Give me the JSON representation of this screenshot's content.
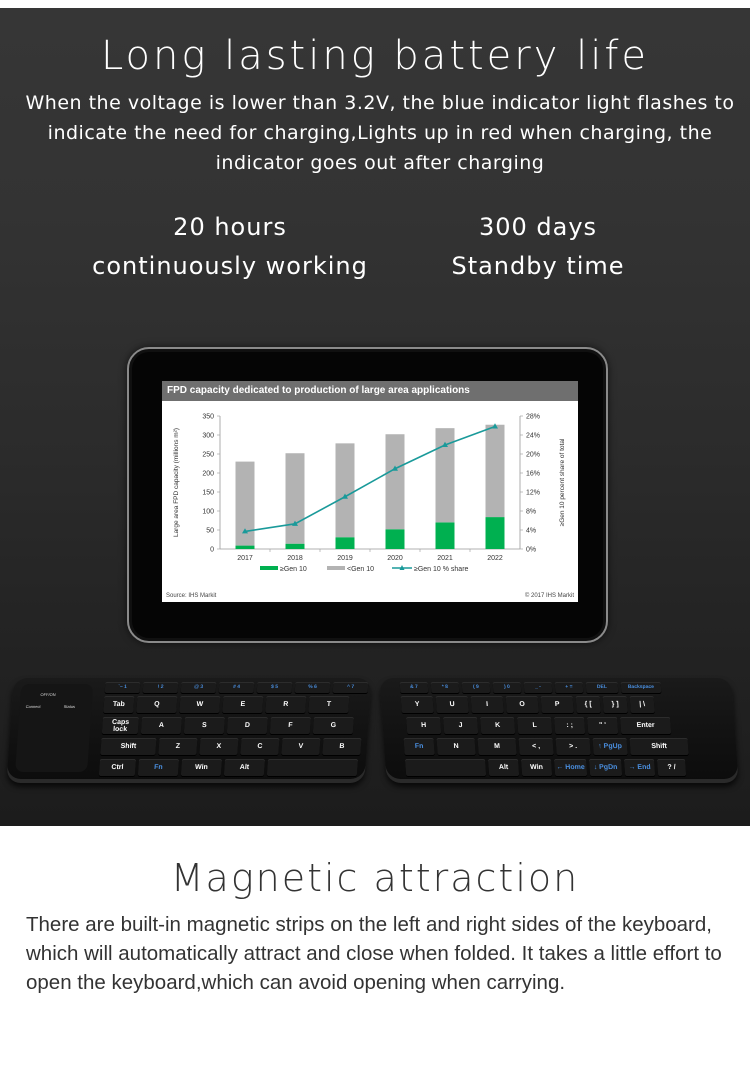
{
  "battery_section": {
    "title": "Long lasting battery life",
    "description": "When the voltage is lower than 3.2V, the blue indicator light flashes to indicate the need for charging,Lights up in red when charging, the indicator goes out after charging",
    "stats": [
      {
        "value": "20 hours",
        "label": "continuously working"
      },
      {
        "value": "300 days",
        "label": "Standby time"
      }
    ]
  },
  "colors": {
    "gen10_green": "#00b050",
    "lt_gen10_gray": "#b3b3b3",
    "share_line_teal": "#1a9a9a",
    "dark_bg": "#333333",
    "text_light": "#ffffff",
    "text_dark": "#333333"
  },
  "chart_data": {
    "type": "bar",
    "title": "FPD capacity dedicated to production of large area applications",
    "categories": [
      "2017",
      "2018",
      "2019",
      "2020",
      "2021",
      "2022"
    ],
    "series": [
      {
        "name": "≥Gen 10",
        "kind": "stacked-bar",
        "values": [
          9,
          14,
          31,
          52,
          70,
          84
        ]
      },
      {
        "name": "<Gen 10",
        "kind": "stacked-bar",
        "values": [
          221,
          238,
          247,
          250,
          248,
          243
        ]
      },
      {
        "name": "≥Gen 10 % share",
        "kind": "line",
        "axis": "right",
        "values": [
          3.7,
          5.3,
          11.0,
          16.9,
          21.9,
          25.8
        ]
      }
    ],
    "totals": [
      230,
      252,
      278,
      302,
      318,
      327
    ],
    "ylabel": "Large area FPD capacity (millions m²)",
    "ylabel_right": "≥Gen 10 percent share of total",
    "xlabel": "",
    "ylim": [
      0,
      350
    ],
    "yticks": [
      "0",
      "50",
      "100",
      "150",
      "200",
      "250",
      "300",
      "350"
    ],
    "ylim_right": [
      0,
      28
    ],
    "yticks_right": [
      "0%",
      "4%",
      "8%",
      "12%",
      "16%",
      "20%",
      "24%",
      "28%"
    ],
    "legend": [
      "≥Gen 10",
      "<Gen 10",
      "≥Gen 10 % share"
    ],
    "legend_position": "bottom",
    "grid": false,
    "source": "Source: IHS Markit",
    "copyright": "© 2017 IHS Markit"
  },
  "keyboard": {
    "left": {
      "pad_labels": [
        "OFF/ON",
        "Connect",
        "Status"
      ],
      "fn_row": [
        "`~ 1",
        "! 2",
        "@ 3",
        "# 4",
        "$ 5",
        "% 6",
        "^ 7"
      ],
      "row1": [
        "Tab",
        "Q",
        "W",
        "E",
        "R",
        "T"
      ],
      "row2": [
        "Caps\nlock",
        "A",
        "S",
        "D",
        "F",
        "G"
      ],
      "row3": [
        "Shift",
        "Z",
        "X",
        "C",
        "V",
        "B"
      ],
      "row4": [
        "Ctrl",
        "Fn",
        "Win",
        "Alt",
        ""
      ]
    },
    "right": {
      "fn_row": [
        "& 7",
        "* 8",
        "( 9",
        ") 0",
        "_ -",
        "+ =",
        "DEL",
        "Backspace"
      ],
      "row1": [
        "Y",
        "U",
        "I",
        "O",
        "P",
        "{ [",
        "} ]",
        "| \\"
      ],
      "row2": [
        "H",
        "J",
        "K",
        "L",
        ": ;",
        "\" '",
        "Enter"
      ],
      "row3": [
        "Fn",
        "N",
        "M",
        "< ,",
        "> .",
        "↑ PgUp",
        "Shift"
      ],
      "row4": [
        "",
        "Alt",
        "Win",
        "← Home",
        "↓ PgDn",
        "→ End",
        "? /"
      ]
    }
  },
  "magnetic_section": {
    "title": "Magnetic attraction",
    "description": "There are built-in magnetic strips on the left and right sides of the keyboard, which will automatically attract and close when folded. It takes a little effort to open the keyboard,which can avoid opening when carrying."
  }
}
